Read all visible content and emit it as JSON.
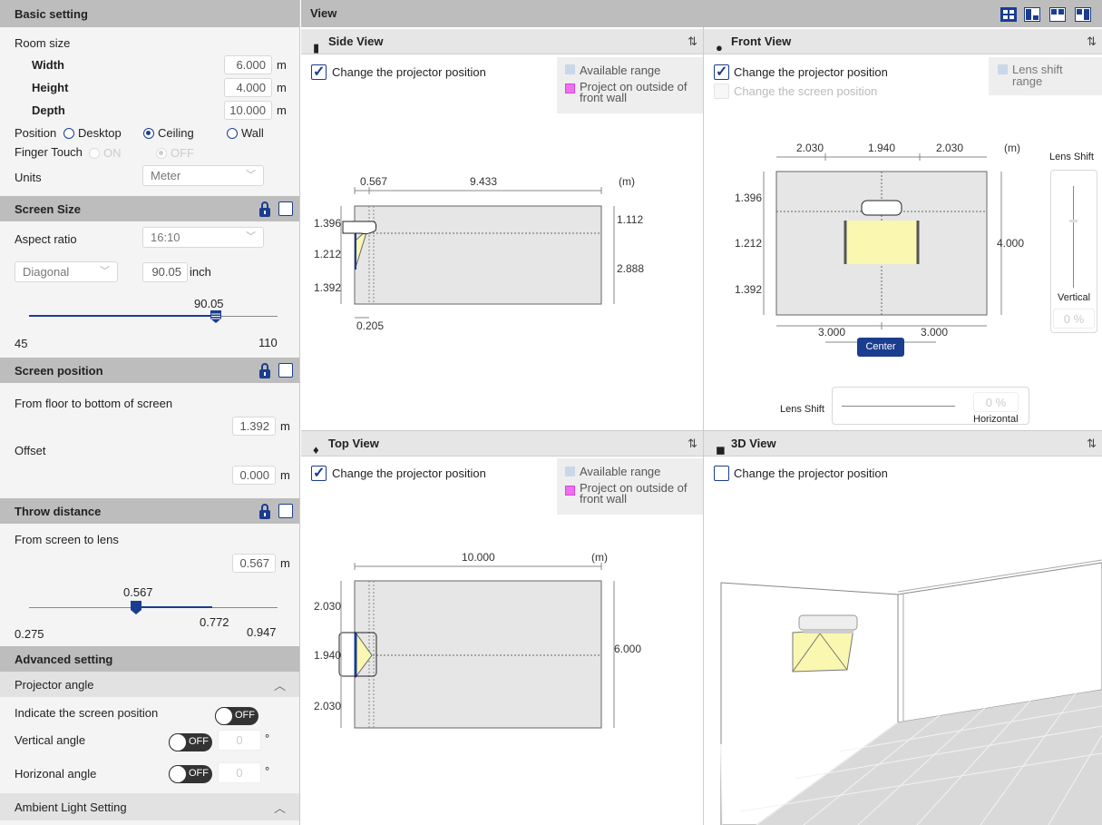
{
  "basic": {
    "title": "Basic setting",
    "room_size": "Room size",
    "width_label": "Width",
    "width_value": "6.000",
    "height_label": "Height",
    "height_value": "4.000",
    "depth_label": "Depth",
    "depth_value": "10.000",
    "unit_m": "m",
    "position_label": "Position",
    "pos_desktop": "Desktop",
    "pos_ceiling": "Ceiling",
    "pos_wall": "Wall",
    "finger_touch": "Finger Touch",
    "ft_on": "ON",
    "ft_off": "OFF",
    "units_label": "Units",
    "units_value": "Meter"
  },
  "screen_size": {
    "title": "Screen Size",
    "aspect_label": "Aspect ratio",
    "aspect_value": "16:10",
    "diag_select": "Diagonal",
    "diag_value": "90.05",
    "diag_unit": "inch",
    "slider_value": "90.05",
    "slider_min": "45",
    "slider_max": "110",
    "slider_fraction": 0.75
  },
  "screen_position": {
    "title": "Screen position",
    "floor_label": "From floor to bottom of screen",
    "floor_value": "1.392",
    "offset_label": "Offset",
    "offset_value": "0.000"
  },
  "throw": {
    "title": "Throw distance",
    "from_label": "From screen to lens",
    "value": "0.567",
    "slider_value": "0.567",
    "slider_mid": "0.772",
    "slider_min": "0.275",
    "slider_max": "0.947"
  },
  "advanced": {
    "title": "Advanced setting",
    "proj_angle": "Projector angle",
    "indicate": "Indicate the screen position",
    "vertical": "Vertical angle",
    "horizontal": "Horizonal angle",
    "off": "OFF",
    "zero": "0",
    "deg": "°",
    "ambient": "Ambient Light Setting"
  },
  "view": {
    "title": "View",
    "side": {
      "title": "Side View",
      "change_proj": "Change the projector position",
      "legend_avail": "Available range",
      "legend_outside": "Project on outside of front wall",
      "d_throw": "0.567",
      "d_rest": "9.433",
      "unit": "(m)",
      "l_top": "1.396",
      "l_mid": "1.212",
      "l_bot": "1.392",
      "r_top": "1.112",
      "r_bot": "2.888",
      "b_val": "0.205"
    },
    "front": {
      "title": "Front View",
      "change_proj": "Change the projector position",
      "change_screen": "Change the screen position",
      "legend_lens": "Lens shift range",
      "t_left": "2.030",
      "t_mid": "1.940",
      "t_right": "2.030",
      "unit": "(m)",
      "l_top": "1.396",
      "l_mid": "1.212",
      "l_bot": "1.392",
      "r_height": "4.000",
      "b_left": "3.000",
      "b_right": "3.000",
      "center_btn": "Center",
      "lens_shift": "Lens Shift",
      "vertical": "Vertical",
      "v_value": "0 %",
      "h_value": "0 %",
      "horizontal": "Horizontal"
    },
    "top": {
      "title": "Top View",
      "change_proj": "Change the projector position",
      "legend_avail": "Available range",
      "legend_outside": "Project on outside of front wall",
      "d_depth": "10.000",
      "unit": "(m)",
      "l_top": "2.030",
      "l_mid": "1.940",
      "l_bot": "2.030",
      "r_width": "6.000"
    },
    "three_d": {
      "title": "3D View",
      "change_proj": "Change the projector position"
    }
  },
  "colors": {
    "accent": "#1a3d8f",
    "header": "#bdbdbd",
    "screen": "#faf7b0",
    "legend_avail": "#c9d7ea",
    "legend_outside": "#f06ef0"
  }
}
